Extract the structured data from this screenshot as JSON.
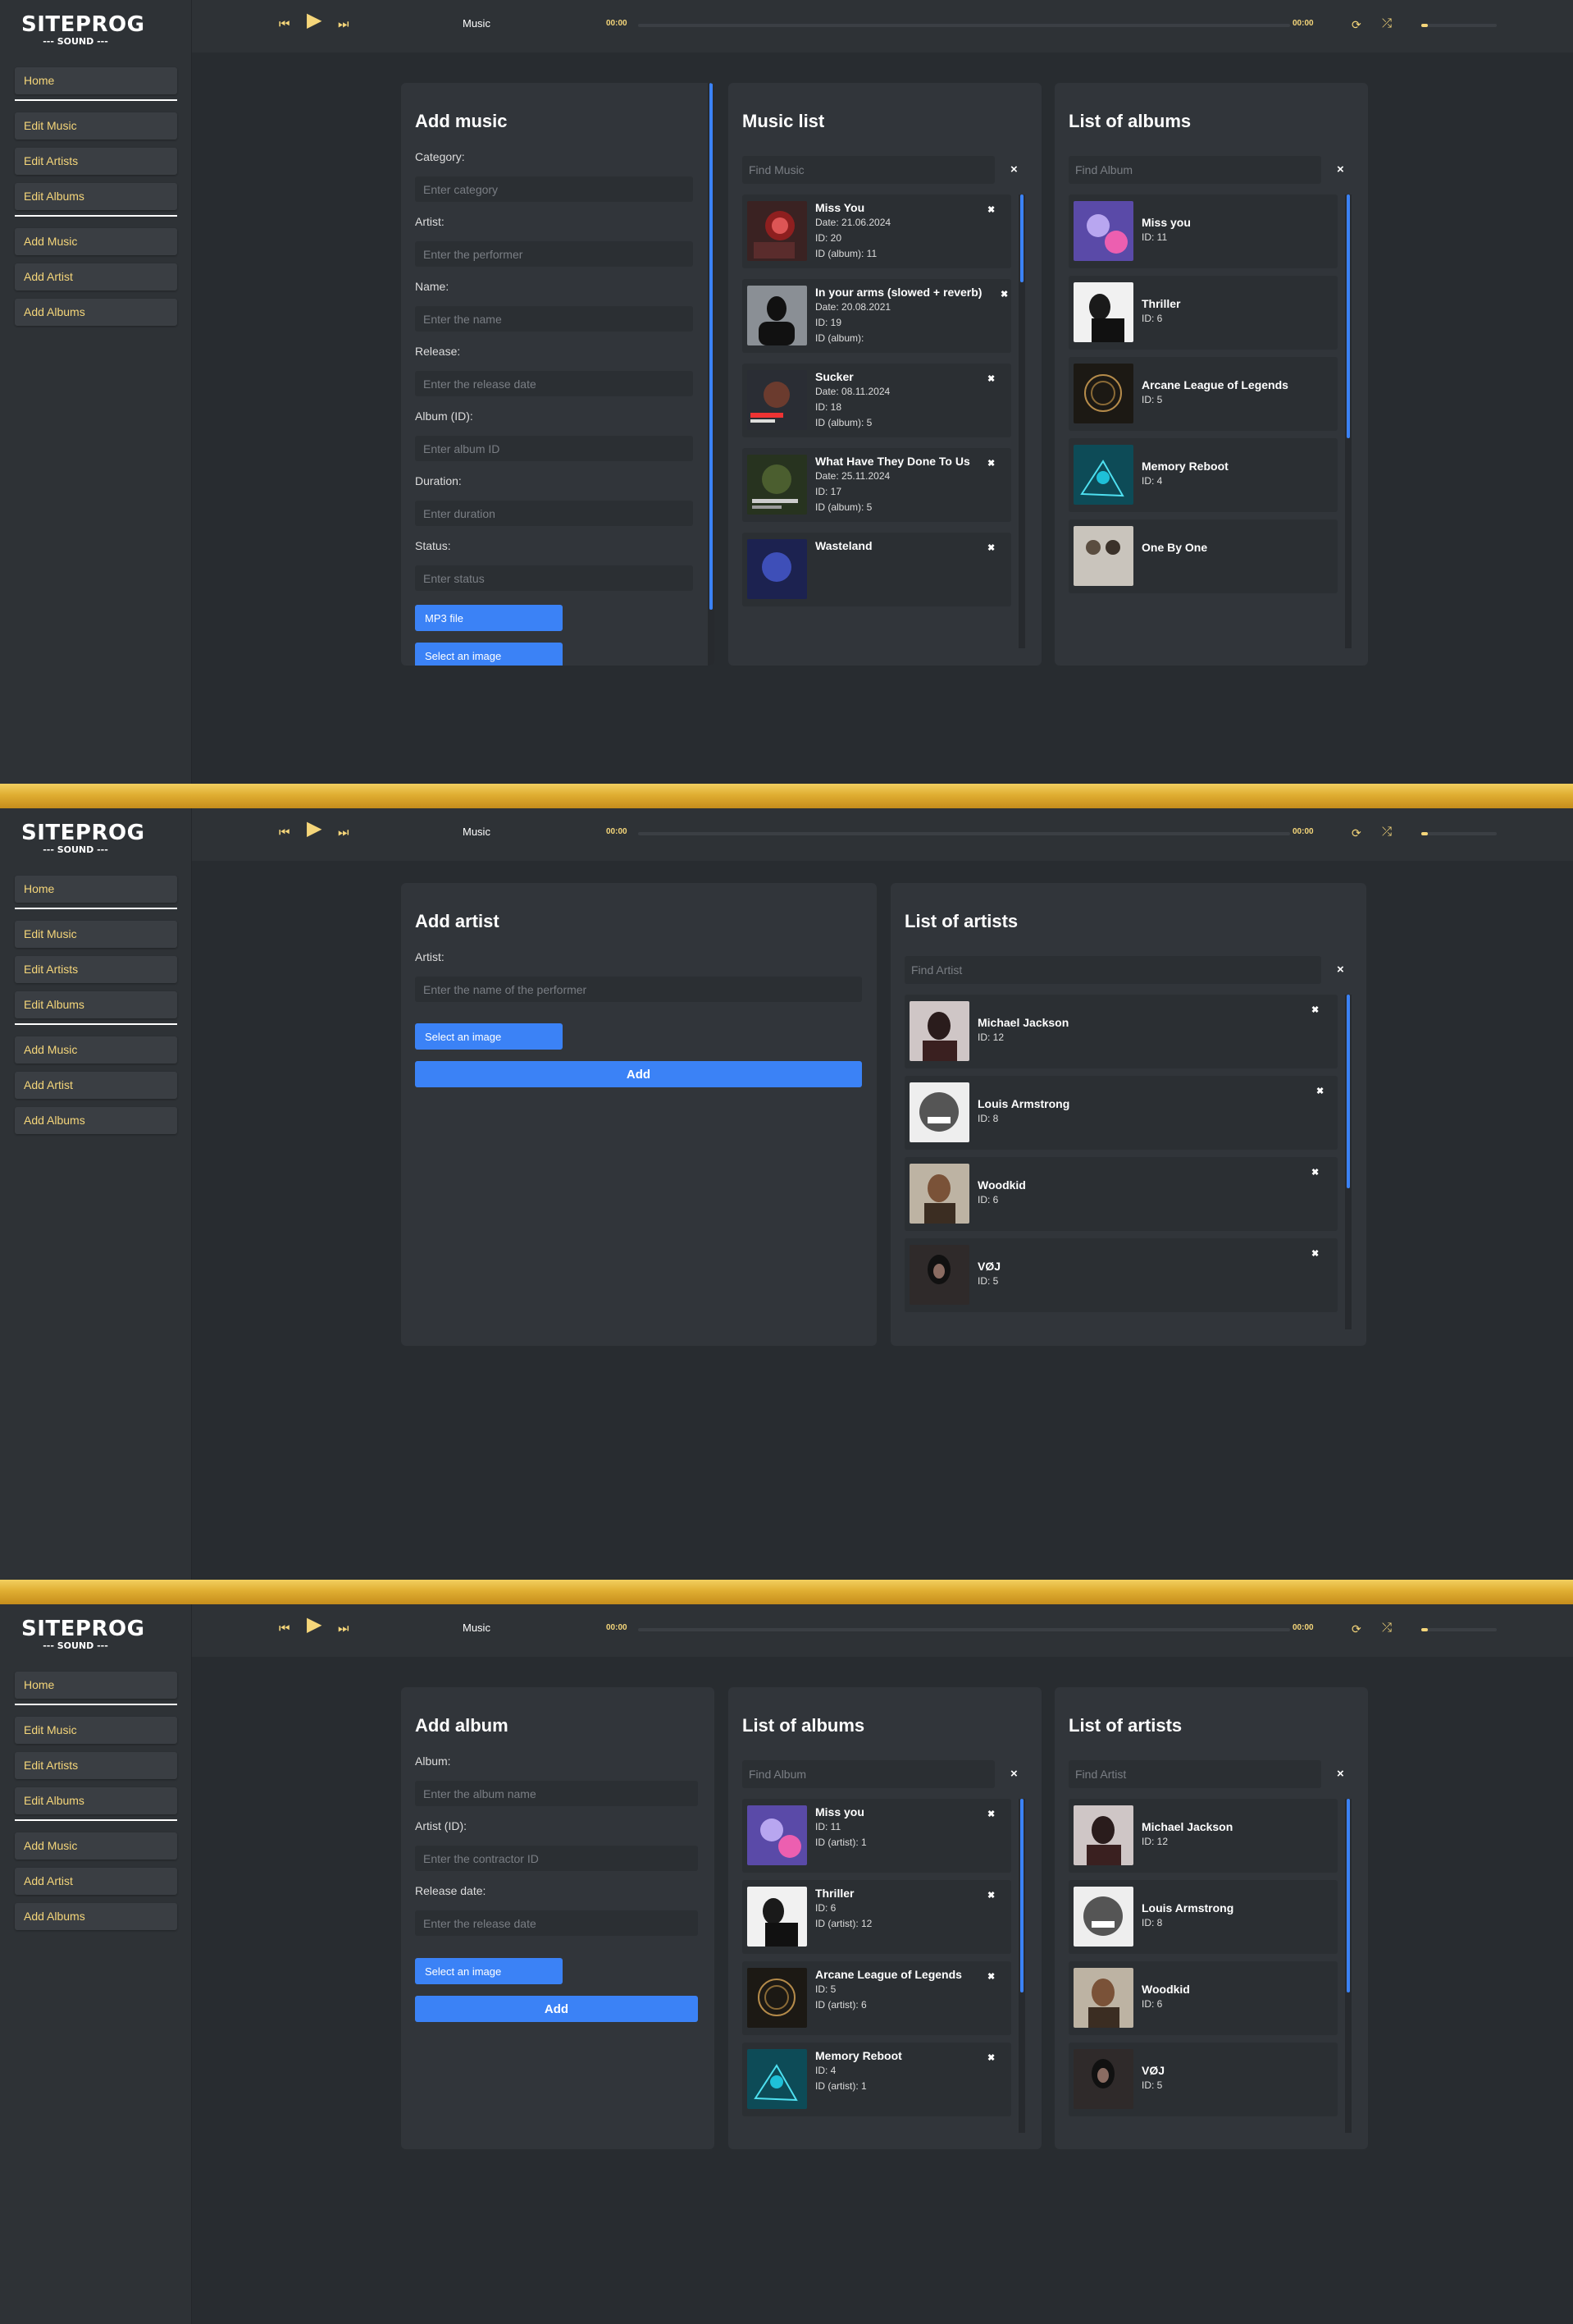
{
  "logo": {
    "line1": "SITEPROG",
    "line2": "--- SOUND ---"
  },
  "nav": {
    "home": "Home",
    "edit_music": "Edit Music",
    "edit_artists": "Edit Artists",
    "edit_albums": "Edit Albums",
    "add_music": "Add Music",
    "add_artist": "Add Artist",
    "add_albums": "Add Albums"
  },
  "player": {
    "title": "Music",
    "current_time": "00:00",
    "total_time": "00:00",
    "prev_icon": "skip-back-icon",
    "play_icon": "play-icon",
    "next_icon": "skip-forward-icon",
    "repeat_icon": "repeat-icon",
    "shuffle_icon": "shuffle-icon",
    "accent": "#f5d67a"
  },
  "colors": {
    "button_blue": "#3b82f6",
    "divider_gold": "#e0ae32",
    "background": "#282c30"
  },
  "add_music": {
    "title": "Add music",
    "fields": [
      {
        "label": "Category:",
        "placeholder": "Enter category"
      },
      {
        "label": "Artist:",
        "placeholder": "Enter the performer"
      },
      {
        "label": "Name:",
        "placeholder": "Enter the name"
      },
      {
        "label": "Release:",
        "placeholder": "Enter the release date"
      },
      {
        "label": "Album (ID):",
        "placeholder": "Enter album ID"
      },
      {
        "label": "Duration:",
        "placeholder": "Enter duration"
      },
      {
        "label": "Status:",
        "placeholder": "Enter status"
      }
    ],
    "mp3_button": "MP3 file",
    "image_button": "Select an image"
  },
  "music_list": {
    "title": "Music list",
    "search_placeholder": "Find Music",
    "clear": "×",
    "items": [
      {
        "name": "Miss You",
        "date": "Date: 21.06.2024",
        "id": "ID: 20",
        "album": "ID (album): 11"
      },
      {
        "name": "In your arms (slowed + reverb)",
        "date": "Date: 20.08.2021",
        "id": "ID: 19",
        "album": "ID (album):"
      },
      {
        "name": "Sucker",
        "date": "Date: 08.11.2024",
        "id": "ID: 18",
        "album": "ID (album): 5"
      },
      {
        "name": "What Have They Done To Us",
        "date": "Date: 25.11.2024",
        "id": "ID: 17",
        "album": "ID (album): 5"
      },
      {
        "name": "Wasteland",
        "date": "",
        "id": "",
        "album": ""
      }
    ]
  },
  "albums_short": {
    "title": "List of albums",
    "search_placeholder": "Find Album",
    "clear": "×",
    "items": [
      {
        "name": "Miss you",
        "id": "ID: 11"
      },
      {
        "name": "Thriller",
        "id": "ID: 6"
      },
      {
        "name": "Arcane League of Legends",
        "id": "ID: 5"
      },
      {
        "name": "Memory Reboot",
        "id": "ID: 4"
      },
      {
        "name": "One By One",
        "id": ""
      }
    ]
  },
  "add_artist": {
    "title": "Add artist",
    "label": "Artist:",
    "placeholder": "Enter the name of the performer",
    "image_button": "Select an image",
    "add_button": "Add"
  },
  "artists_full": {
    "title": "List of artists",
    "search_placeholder": "Find Artist",
    "clear": "×",
    "items": [
      {
        "name": "Michael Jackson",
        "id": "ID: 12"
      },
      {
        "name": "Louis Armstrong",
        "id": "ID: 8"
      },
      {
        "name": "Woodkid",
        "id": "ID: 6"
      },
      {
        "name": "VØJ",
        "id": "ID: 5"
      }
    ]
  },
  "add_album": {
    "title": "Add album",
    "fields": [
      {
        "label": "Album:",
        "placeholder": "Enter the album name"
      },
      {
        "label": "Artist (ID):",
        "placeholder": "Enter the contractor ID"
      },
      {
        "label": "Release date:",
        "placeholder": "Enter the release date"
      }
    ],
    "image_button": "Select an image",
    "add_button": "Add"
  },
  "albums_full": {
    "title": "List of albums",
    "search_placeholder": "Find Album",
    "clear": "×",
    "items": [
      {
        "name": "Miss you",
        "id": "ID: 11",
        "artist": "ID (artist): 1"
      },
      {
        "name": "Thriller",
        "id": "ID: 6",
        "artist": "ID (artist): 12"
      },
      {
        "name": "Arcane League of Legends",
        "id": "ID: 5",
        "artist": "ID (artist): 6"
      },
      {
        "name": "Memory Reboot",
        "id": "ID: 4",
        "artist": "ID (artist): 1"
      }
    ]
  },
  "artists_short": {
    "title": "List of artists",
    "search_placeholder": "Find Artist",
    "clear": "×",
    "items": [
      {
        "name": "Michael Jackson",
        "id": "ID: 12"
      },
      {
        "name": "Louis Armstrong",
        "id": "ID: 8"
      },
      {
        "name": "Woodkid",
        "id": "ID: 6"
      },
      {
        "name": "VØJ",
        "id": "ID: 5"
      }
    ]
  }
}
